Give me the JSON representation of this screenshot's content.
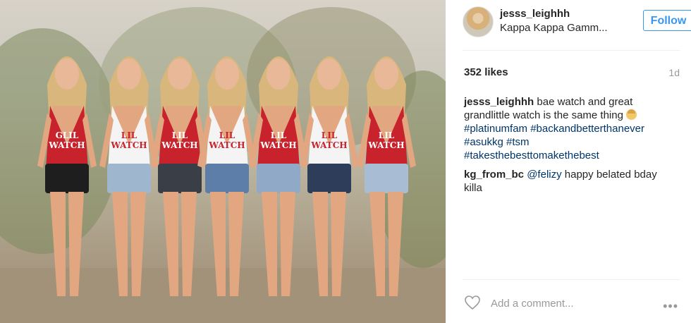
{
  "header": {
    "username": "jesss_leighhh",
    "location": "Kappa Kappa Gamm...",
    "follow_label": "Follow"
  },
  "post": {
    "likes": "352 likes",
    "time": "1d",
    "shirt_texts": [
      "GLIL WATCH",
      "LIL WATCH",
      "LIL WATCH",
      "LIL WATCH",
      "LIL WATCH",
      "LIL WATCH",
      "LIL WATCH"
    ]
  },
  "comments": [
    {
      "user": "jesss_leighhh",
      "text": "bae watch and great grandlittle watch is the same thing",
      "hashtags": [
        "#platinumfam",
        "#backandbetterthanever",
        "#asukkg",
        "#tsm",
        "#takesthebesttomakethebest"
      ]
    },
    {
      "user": "kg_from_bc",
      "mention": "@felizy",
      "text": "happy belated bday killa"
    }
  ],
  "add_comment": {
    "placeholder": "Add a comment..."
  },
  "more_label": "•••",
  "colors": {
    "accent": "#3897f0",
    "hashtag": "#003569",
    "red_swimsuit": "#c8232c"
  }
}
